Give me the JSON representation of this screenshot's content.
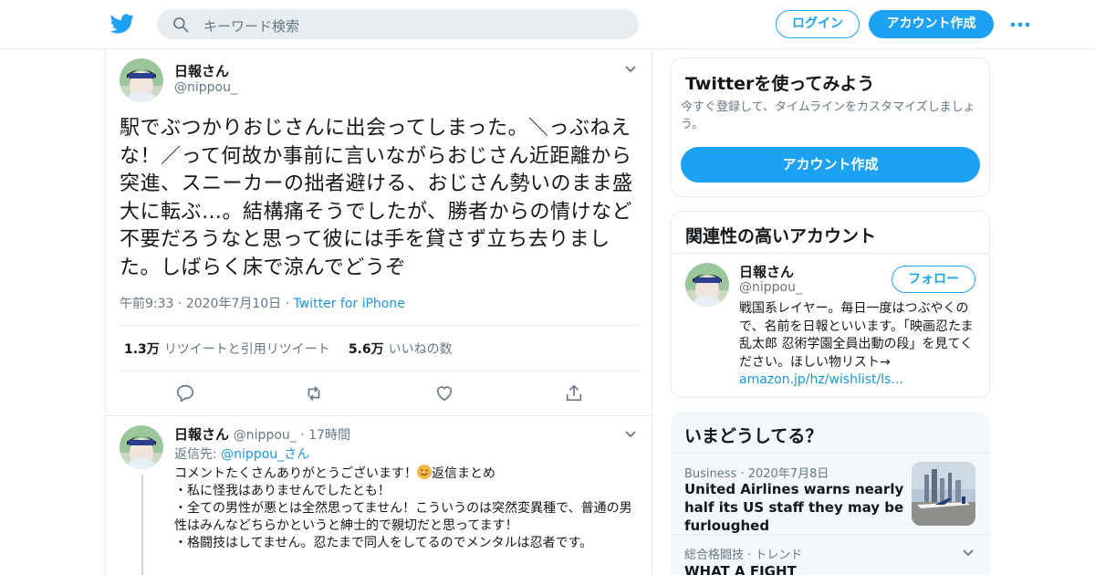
{
  "header": {
    "search_placeholder": "キーワード検索",
    "login_label": "ログイン",
    "signup_label": "アカウント作成",
    "accent_color": "#1da1f2"
  },
  "tweet": {
    "author_name": "日報さん",
    "author_handle": "@nippou_",
    "text": "駅でぶつかりおじさんに出会ってしまった。＼っぶねえな！／って何故か事前に言いながらおじさん近距離から突進、スニーカーの拙者避ける、おじさん勢いのまま盛大に転ぶ…。結構痛そうでしたが、勝者からの情けなど不要だろうなと思って彼には手を貸さず立ち去りました。しばらく床で涼んでどうぞ",
    "time": "午前9:33",
    "date": "2020年7月10日",
    "source": "Twitter for iPhone",
    "retweets_count": "1.3万",
    "retweets_label": "リツイートと引用リツイート",
    "likes_count": "5.6万",
    "likes_label": "いいねの数"
  },
  "reply": {
    "author_name": "日報さん",
    "author_handle": "@nippou_",
    "age": "17時間",
    "reply_to_label": "返信先:",
    "reply_to_handle": "@nippou_",
    "reply_to_suffix": "さん",
    "line1_before": "コメントたくさんありがとうございます！",
    "line1_after": "返信まとめ",
    "body": "\n・私に怪我はありませんでしたとも！\n・全ての男性が悪とは全然思ってません！こういうのは突然変異種で、普通の男性はみんなどちらかというと紳士的で親切だと思ってます！\n・格闘技はしてません。忍たまで同人をしてるのでメンタルは忍者です。"
  },
  "sidebar": {
    "signup_card": {
      "title": "Twitterを使ってみよう",
      "subtitle": "今すぐ登録して、タイムラインをカスタマイズしましょう。",
      "button": "アカウント作成"
    },
    "related_card": {
      "title": "関連性の高いアカウント",
      "name": "日報さん",
      "handle": "@nippou_",
      "follow": "フォロー",
      "bio": "戦国系レイヤー。毎日一度はつぶやくので、名前を日報といいます。「映画忍たま乱太郎 忍術学園全員出動の段」を見てください。ほしい物リスト→ ",
      "bio_link": "amazon.jp/hz/wishlist/ls..."
    },
    "trends_card": {
      "title": "いまどうしてる？",
      "items": [
        {
          "meta": "Business · 2020年7月8日",
          "title": "United Airlines warns nearly half its US staff they may be furloughed"
        },
        {
          "meta": "総合格闘技 · トレンド",
          "title": "WHAT A FIGHT"
        }
      ]
    }
  }
}
